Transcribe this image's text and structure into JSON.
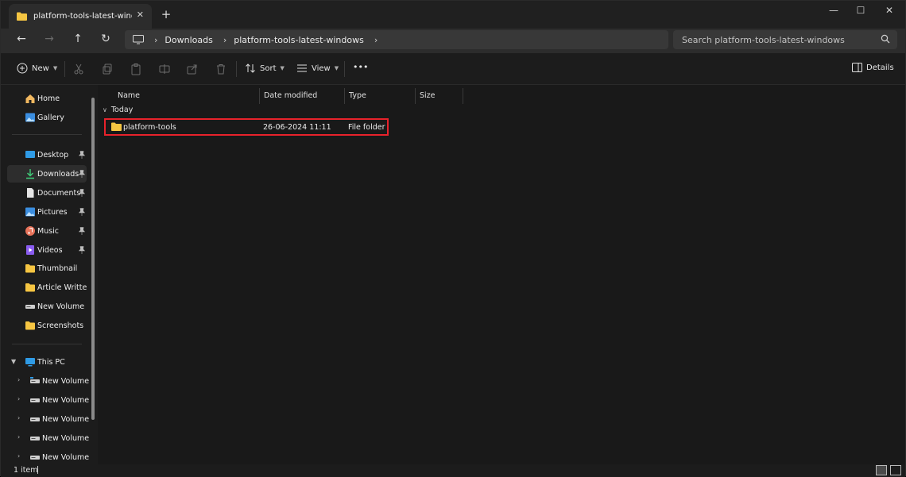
{
  "window": {
    "tab": {
      "title": "platform-tools-latest-windows",
      "icon": "folder-icon"
    },
    "controls": {
      "minimize": "—",
      "maximize": "☐",
      "close": "✕"
    },
    "new_tab": "+"
  },
  "navigation": {
    "back": "←",
    "forward": "→",
    "up": "↑",
    "refresh": "↻",
    "breadcrumb": [
      "Downloads",
      "platform-tools-latest-windows"
    ],
    "search_placeholder": "Search platform-tools-latest-windows"
  },
  "commandbar": {
    "new_label": "New",
    "sort_label": "Sort",
    "view_label": "View",
    "more_label": "•••",
    "details_label": "Details"
  },
  "sidebar": {
    "quick": [
      {
        "label": "Home",
        "icon": "home-icon"
      },
      {
        "label": "Gallery",
        "icon": "gallery-icon"
      }
    ],
    "pinned": [
      {
        "label": "Desktop",
        "icon": "desktop-icon",
        "pinned": true
      },
      {
        "label": "Downloads",
        "icon": "download-icon",
        "pinned": true,
        "selected": true
      },
      {
        "label": "Documents",
        "icon": "document-icon",
        "pinned": true
      },
      {
        "label": "Pictures",
        "icon": "pictures-icon",
        "pinned": true
      },
      {
        "label": "Music",
        "icon": "music-icon",
        "pinned": true
      },
      {
        "label": "Videos",
        "icon": "videos-icon",
        "pinned": true
      },
      {
        "label": "Thumbnail",
        "icon": "folder-icon"
      },
      {
        "label": "Article Written",
        "icon": "folder-icon"
      },
      {
        "label": "New Volume (G:",
        "icon": "drive-icon"
      },
      {
        "label": "Screenshots",
        "icon": "folder-icon"
      }
    ],
    "this_pc": {
      "label": "This PC",
      "icon": "pc-icon"
    },
    "volumes": [
      "New Volume (",
      "New Volume (I",
      "New Volume (I",
      "New Volume (I",
      "New Volume ("
    ]
  },
  "columns": [
    "Name",
    "Date modified",
    "Type",
    "Size"
  ],
  "group": {
    "label": "Today"
  },
  "files": [
    {
      "name": "platform-tools",
      "date_modified": "26-06-2024 11:11",
      "type": "File folder",
      "size": ""
    }
  ],
  "status": {
    "item_count": "1 item"
  },
  "colors": {
    "accent": "#4cc2ff",
    "folder": "#f5c542",
    "highlight_box": "#e8222b"
  }
}
